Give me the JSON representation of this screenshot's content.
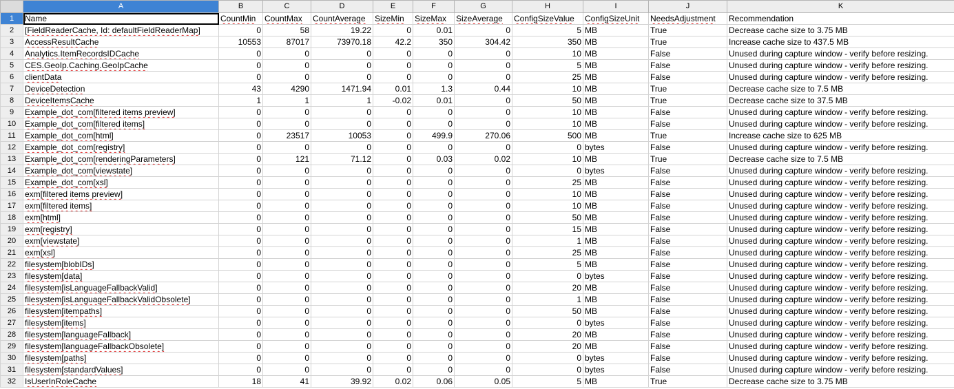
{
  "columns": [
    "A",
    "B",
    "C",
    "D",
    "E",
    "F",
    "G",
    "H",
    "I",
    "J",
    "K"
  ],
  "header_row": [
    "Name",
    "CountMin",
    "CountMax",
    "CountAverage",
    "SizeMin",
    "SizeMax",
    "SizeAverage",
    "ConfigSizeValue",
    "ConfigSizeUnit",
    "NeedsAdjustment",
    "Recommendation"
  ],
  "rows": [
    [
      "[FieldReaderCache, Id: defaultFieldReaderMap]",
      "0",
      "58",
      "19.22",
      "0",
      "0.01",
      "0",
      "5",
      "MB",
      "True",
      "Decrease cache size to 3.75 MB"
    ],
    [
      "AccessResultCache",
      "10553",
      "87017",
      "73970.18",
      "42.2",
      "350",
      "304.42",
      "350",
      "MB",
      "True",
      "Increase cache size to 437.5 MB"
    ],
    [
      "Analytics.ItemRecordsIDCache",
      "0",
      "0",
      "0",
      "0",
      "0",
      "0",
      "10",
      "MB",
      "False",
      "Unused during capture window - verify before resizing."
    ],
    [
      "CES.GeoIp.Caching.GeoIpCache",
      "0",
      "0",
      "0",
      "0",
      "0",
      "0",
      "5",
      "MB",
      "False",
      "Unused during capture window - verify before resizing."
    ],
    [
      "clientData",
      "0",
      "0",
      "0",
      "0",
      "0",
      "0",
      "25",
      "MB",
      "False",
      "Unused during capture window - verify before resizing."
    ],
    [
      "DeviceDetection",
      "43",
      "4290",
      "1471.94",
      "0.01",
      "1.3",
      "0.44",
      "10",
      "MB",
      "True",
      "Decrease cache size to 7.5 MB"
    ],
    [
      "DeviceItemsCache",
      "1",
      "1",
      "1",
      "-0.02",
      "0.01",
      "0",
      "50",
      "MB",
      "True",
      "Decrease cache size to 37.5 MB"
    ],
    [
      "Example_dot_com[filtered items preview]",
      "0",
      "0",
      "0",
      "0",
      "0",
      "0",
      "10",
      "MB",
      "False",
      "Unused during capture window - verify before resizing."
    ],
    [
      "Example_dot_com[filtered items]",
      "0",
      "0",
      "0",
      "0",
      "0",
      "0",
      "10",
      "MB",
      "False",
      "Unused during capture window - verify before resizing."
    ],
    [
      "Example_dot_com[html]",
      "0",
      "23517",
      "10053",
      "0",
      "499.9",
      "270.06",
      "500",
      "MB",
      "True",
      "Increase cache size to 625 MB"
    ],
    [
      "Example_dot_com[registry]",
      "0",
      "0",
      "0",
      "0",
      "0",
      "0",
      "0",
      "bytes",
      "False",
      "Unused during capture window - verify before resizing."
    ],
    [
      "Example_dot_com[renderingParameters]",
      "0",
      "121",
      "71.12",
      "0",
      "0.03",
      "0.02",
      "10",
      "MB",
      "True",
      "Decrease cache size to 7.5 MB"
    ],
    [
      "Example_dot_com[viewstate]",
      "0",
      "0",
      "0",
      "0",
      "0",
      "0",
      "0",
      "bytes",
      "False",
      "Unused during capture window - verify before resizing."
    ],
    [
      "Example_dot_com[xsl]",
      "0",
      "0",
      "0",
      "0",
      "0",
      "0",
      "25",
      "MB",
      "False",
      "Unused during capture window - verify before resizing."
    ],
    [
      "exm[filtered items preview]",
      "0",
      "0",
      "0",
      "0",
      "0",
      "0",
      "10",
      "MB",
      "False",
      "Unused during capture window - verify before resizing."
    ],
    [
      "exm[filtered items]",
      "0",
      "0",
      "0",
      "0",
      "0",
      "0",
      "10",
      "MB",
      "False",
      "Unused during capture window - verify before resizing."
    ],
    [
      "exm[html]",
      "0",
      "0",
      "0",
      "0",
      "0",
      "0",
      "50",
      "MB",
      "False",
      "Unused during capture window - verify before resizing."
    ],
    [
      "exm[registry]",
      "0",
      "0",
      "0",
      "0",
      "0",
      "0",
      "15",
      "MB",
      "False",
      "Unused during capture window - verify before resizing."
    ],
    [
      "exm[viewstate]",
      "0",
      "0",
      "0",
      "0",
      "0",
      "0",
      "1",
      "MB",
      "False",
      "Unused during capture window - verify before resizing."
    ],
    [
      "exm[xsl]",
      "0",
      "0",
      "0",
      "0",
      "0",
      "0",
      "25",
      "MB",
      "False",
      "Unused during capture window - verify before resizing."
    ],
    [
      "filesystem[blobIDs]",
      "0",
      "0",
      "0",
      "0",
      "0",
      "0",
      "5",
      "MB",
      "False",
      "Unused during capture window - verify before resizing."
    ],
    [
      "filesystem[data]",
      "0",
      "0",
      "0",
      "0",
      "0",
      "0",
      "0",
      "bytes",
      "False",
      "Unused during capture window - verify before resizing."
    ],
    [
      "filesystem[isLanguageFallbackValid]",
      "0",
      "0",
      "0",
      "0",
      "0",
      "0",
      "20",
      "MB",
      "False",
      "Unused during capture window - verify before resizing."
    ],
    [
      "filesystem[isLanguageFallbackValidObsolete]",
      "0",
      "0",
      "0",
      "0",
      "0",
      "0",
      "1",
      "MB",
      "False",
      "Unused during capture window - verify before resizing."
    ],
    [
      "filesystem[itempaths]",
      "0",
      "0",
      "0",
      "0",
      "0",
      "0",
      "50",
      "MB",
      "False",
      "Unused during capture window - verify before resizing."
    ],
    [
      "filesystem[items]",
      "0",
      "0",
      "0",
      "0",
      "0",
      "0",
      "0",
      "bytes",
      "False",
      "Unused during capture window - verify before resizing."
    ],
    [
      "filesystem[languageFallback]",
      "0",
      "0",
      "0",
      "0",
      "0",
      "0",
      "20",
      "MB",
      "False",
      "Unused during capture window - verify before resizing."
    ],
    [
      "filesystem[languageFallbackObsolete]",
      "0",
      "0",
      "0",
      "0",
      "0",
      "0",
      "20",
      "MB",
      "False",
      "Unused during capture window - verify before resizing."
    ],
    [
      "filesystem[paths]",
      "0",
      "0",
      "0",
      "0",
      "0",
      "0",
      "0",
      "bytes",
      "False",
      "Unused during capture window - verify before resizing."
    ],
    [
      "filesystem[standardValues]",
      "0",
      "0",
      "0",
      "0",
      "0",
      "0",
      "0",
      "bytes",
      "False",
      "Unused during capture window - verify before resizing."
    ],
    [
      "IsUserInRoleCache",
      "18",
      "41",
      "39.92",
      "0.02",
      "0.06",
      "0.05",
      "5",
      "MB",
      "True",
      "Decrease cache size to 3.75 MB"
    ]
  ],
  "colors": {
    "header_bg": "#eeeeee",
    "selected_header_bg": "#3e83d4",
    "grid_line": "#d3d3d3",
    "spellcheck_underline": "#e03030"
  }
}
